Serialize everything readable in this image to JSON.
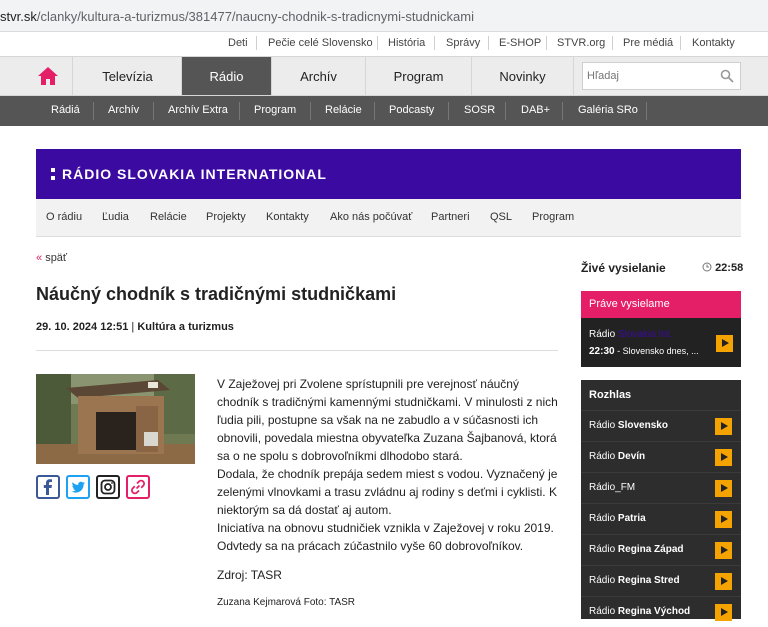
{
  "browser": {
    "url_host": "stvr.sk",
    "url_path": "/clanky/kultura-a-turizmus/381477/naucny-chodnik-s-tradicnymi-studnickami"
  },
  "top_links": [
    "Deti",
    "Pečie celé Slovensko",
    "História",
    "Správy",
    "E-SHOP",
    "STVR.org",
    "Pre médiá",
    "Kontakty"
  ],
  "main_nav": {
    "tabs": [
      "Televízia",
      "Rádio",
      "Archív",
      "Program",
      "Novinky"
    ],
    "active": "Rádio",
    "search_placeholder": "Hľadaj"
  },
  "sub_nav": [
    "Rádiá",
    "Archív",
    "Archív Extra",
    "Program",
    "Relácie",
    "Podcasty",
    "SOSR",
    "DAB+",
    "Galéria SRo"
  ],
  "banner": {
    "title": "RÁDIO SLOVAKIA INTERNATIONAL"
  },
  "rsi_nav": [
    "O rádiu",
    "Ľudia",
    "Relácie",
    "Projekty",
    "Kontakty",
    "Ako nás počúvať",
    "Partneri",
    "QSL",
    "Program"
  ],
  "article": {
    "back_arrow": "«",
    "back_label": "späť",
    "title": "Náučný chodník s tradičnými studničkami",
    "date": "29. 10. 2024 12:51",
    "meta_sep": "|",
    "category": "Kultúra a turizmus",
    "paragraphs": [
      "V Zaježovej pri Zvolene sprístupnili pre verejnosť náučný chodník s tradičnými kamennými studničkami. V minulosti z nich ľudia pili, postupne sa však na ne zabudlo a v súčasnosti ich obnovili, povedala miestna obyvateľka Zuzana Šajbanová, ktorá sa o ne spolu s dobrovoľníkmi dlhodobo stará.",
      "Dodala, že chodník prepája sedem miest s vodou. Vyznačený je zelenými vlnovkami a trasu zvládnu aj rodiny s deťmi i cyklisti. K niektorým sa dá dostať aj autom.",
      "Iniciatíva na obnovu studničiek vznikla v Zaježovej v roku 2019. Odvtedy sa na prácach zúčastnilo vyše 60 dobrovoľníkov."
    ],
    "source": "Zdroj: TASR",
    "author": "Zuzana Kejmarová Foto: TASR"
  },
  "sidebar": {
    "live_title": "Živé vysielanie",
    "live_time": "22:58",
    "now_header": "Práve vysielame",
    "now_station_prefix": "Rádio",
    "now_station_name": "Slovakia Int.",
    "now_time": "22:30",
    "now_program": "- Slovensko dnes, ...",
    "rozhlas_title": "Rozhlas",
    "stations": [
      {
        "prefix": "Rádio",
        "name": "Slovensko"
      },
      {
        "prefix": "Rádio",
        "name": "Devín"
      },
      {
        "prefix": "",
        "name": "Rádio_FM"
      },
      {
        "prefix": "Rádio",
        "name": "Patria"
      },
      {
        "prefix": "Rádio",
        "name": "Regina Západ"
      },
      {
        "prefix": "Rádio",
        "name": "Regina Stred"
      },
      {
        "prefix": "Rádio",
        "name": "Regina Východ"
      }
    ]
  },
  "colors": {
    "accent_pink": "#e51f67",
    "banner_purple": "#3b0aa0",
    "play_orange": "#f4a300",
    "subnav_gray": "#555555"
  }
}
